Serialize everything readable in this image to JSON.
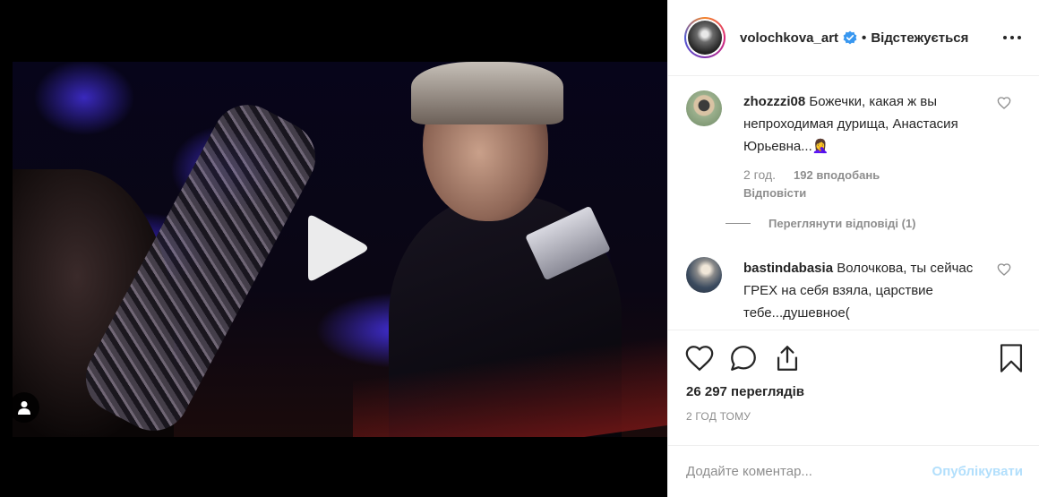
{
  "post": {
    "author": "volochkova_art",
    "verified": true,
    "separator": "•",
    "follow_state": "Відстежується",
    "views": "26 297 переглядів",
    "time": "2 ГОД ТОМУ"
  },
  "comments": [
    {
      "user": "zhozzzi08",
      "text": "Божечки, какая ж вы непроходимая дурища, Анастасия Юрьевна...🤦‍♀️",
      "time": "2 год.",
      "likes": "192 вподобань",
      "reply": "Відповісти",
      "view_replies": "Переглянути відповіді (1)"
    },
    {
      "user": "bastindabasia",
      "text": "Волочкова, ты сейчас ГРЕХ на себя взяла, царствие тебе...душевное("
    }
  ],
  "add_comment": {
    "placeholder": "Додайте коментар...",
    "publish": "Опублікувати"
  },
  "icons": {
    "play": "play-icon",
    "user_tag": "user-icon",
    "verified": "verified-badge-icon",
    "more": "more-options-icon",
    "like": "heart-icon",
    "comment": "comment-icon",
    "share": "share-icon",
    "save": "bookmark-icon"
  },
  "colors": {
    "text": "#262626",
    "muted": "#8e8e8e",
    "verified": "#3897f0",
    "publish_disabled": "#b2dffc"
  }
}
